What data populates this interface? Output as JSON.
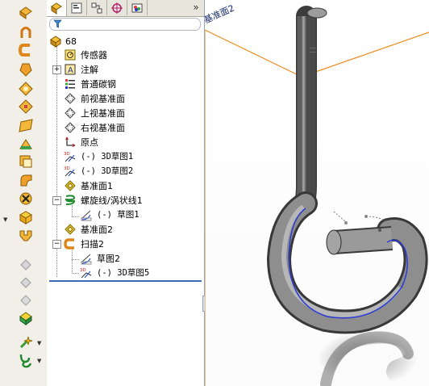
{
  "feature_tree": {
    "root": "68",
    "items": [
      {
        "label": "传感器"
      },
      {
        "label": "注解"
      },
      {
        "label": "普通碳钢"
      },
      {
        "label": "前视基准面"
      },
      {
        "label": "上视基准面"
      },
      {
        "label": "右视基准面"
      },
      {
        "label": "原点"
      },
      {
        "label": "(-) 3D草图1"
      },
      {
        "label": "(-) 3D草图2"
      },
      {
        "label": "基准面1"
      },
      {
        "label": "螺旋线/涡状线1"
      },
      {
        "label": "(-) 草图1"
      },
      {
        "label": "基准面2"
      },
      {
        "label": "扫描2"
      },
      {
        "label": "草图2"
      },
      {
        "label": "(-) 3D草图5"
      }
    ]
  },
  "tabs": {
    "more": "»"
  },
  "graphics": {
    "plane_label": "基准面2"
  },
  "colors": {
    "plane_edge": "#f08a1c",
    "helix": "#2a3bd6",
    "rollback_bar": "#3b6bb8"
  }
}
